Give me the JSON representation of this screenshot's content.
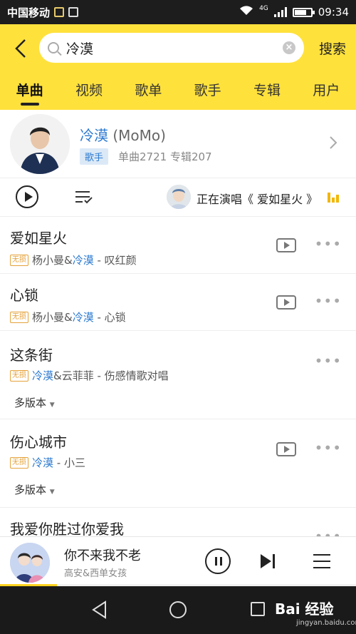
{
  "status_bar": {
    "carrier": "中国移动",
    "network": "4G",
    "time": "09:34"
  },
  "header": {
    "search_value": "冷漠",
    "search_button": "搜索"
  },
  "tabs": [
    {
      "label": "单曲",
      "active": true
    },
    {
      "label": "视频",
      "active": false
    },
    {
      "label": "歌单",
      "active": false
    },
    {
      "label": "歌手",
      "active": false
    },
    {
      "label": "专辑",
      "active": false
    },
    {
      "label": "用户",
      "active": false
    }
  ],
  "artist": {
    "name": "冷漠",
    "name_en": "(MoMo)",
    "tag": "歌手",
    "stats": "单曲2721 专辑207"
  },
  "play_bar": {
    "now_playing": "正在演唱《 爱如星火 》"
  },
  "songs": [
    {
      "title": "爱如星火",
      "badge": "无损",
      "singer_a": "杨小曼&",
      "singer_hl": "冷漠",
      "singer_b": "",
      "album": " - 叹红颜",
      "has_mv": true,
      "versions": ""
    },
    {
      "title": "心锁",
      "badge": "无损",
      "singer_a": "杨小曼&",
      "singer_hl": "冷漠",
      "singer_b": "",
      "album": " - 心锁",
      "has_mv": true,
      "versions": ""
    },
    {
      "title": "这条街",
      "badge": "无损",
      "singer_a": "",
      "singer_hl": "冷漠",
      "singer_b": "&云菲菲",
      "album": " - 伤感情歌对唱",
      "has_mv": false,
      "versions": "多版本"
    },
    {
      "title": "伤心城市",
      "badge": "无损",
      "singer_a": "",
      "singer_hl": "冷漠",
      "singer_b": "",
      "album": " - 小三",
      "has_mv": true,
      "versions": "多版本"
    },
    {
      "title": "我爱你胜过你爱我",
      "badge": "",
      "singer_a": "",
      "singer_hl": "",
      "singer_b": "",
      "album": "",
      "has_mv": false,
      "versions": ""
    }
  ],
  "mini_player": {
    "title": "你不来我不老",
    "artist": "高安&西单女孩",
    "progress": 0.16
  },
  "watermark": {
    "brand": "Bai 经验",
    "url": "jingyan.baidu.com"
  },
  "colors": {
    "accent": "#ffe13c",
    "link": "#2c7ad0",
    "lossless": "#e5a23a"
  }
}
